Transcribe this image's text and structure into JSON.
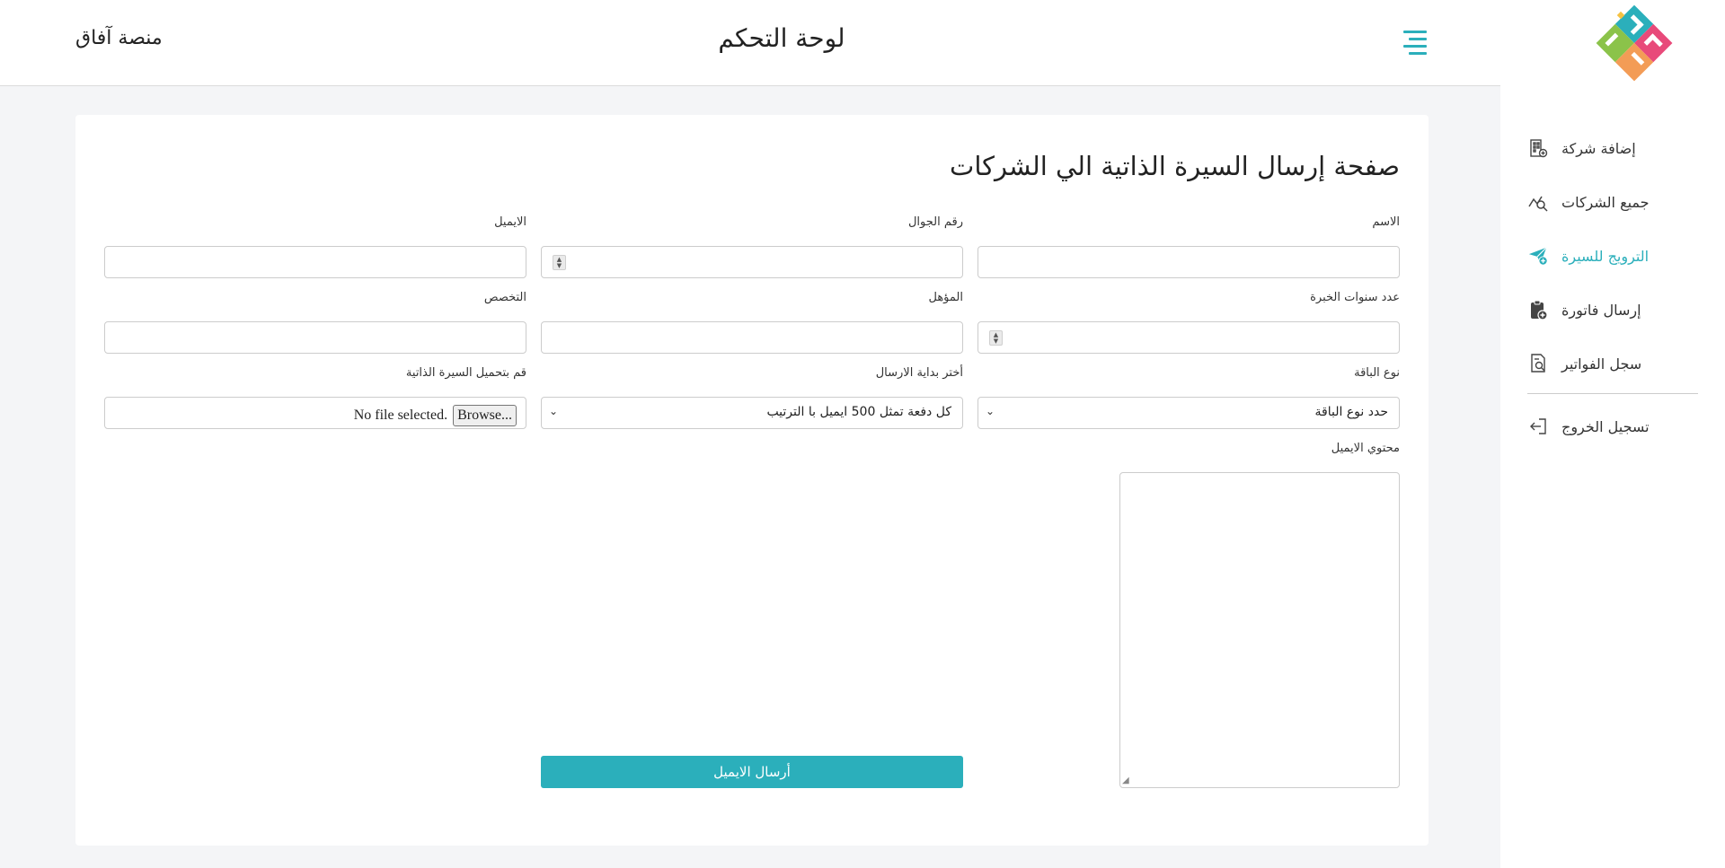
{
  "header": {
    "brand": "منصة آفاق",
    "title": "لوحة التحكم",
    "menu_icon": "hamburger-menu-icon"
  },
  "sidebar": {
    "logo": "afaq-logo",
    "items": [
      {
        "label": "إضافة شركة",
        "icon": "building-add-icon",
        "active": false
      },
      {
        "label": "جميع الشركات",
        "icon": "chart-search-icon",
        "active": false
      },
      {
        "label": "الترويج للسيرة",
        "icon": "paper-plane-icon",
        "active": true
      },
      {
        "label": "إرسال فاتورة",
        "icon": "clipboard-add-icon",
        "active": false
      },
      {
        "label": "سجل الفواتير",
        "icon": "document-search-icon",
        "active": false
      }
    ],
    "logout": {
      "label": "تسجيل الخروج",
      "icon": "logout-icon"
    }
  },
  "form": {
    "title": "صفحة إرسال السيرة الذاتية الي الشركات",
    "fields": {
      "name": {
        "label": "الاسم",
        "value": ""
      },
      "phone": {
        "label": "رقم الجوال",
        "value": ""
      },
      "email": {
        "label": "الايميل",
        "value": ""
      },
      "experience": {
        "label": "عدد سنوات الخبرة",
        "value": ""
      },
      "qualification": {
        "label": "المؤهل",
        "value": ""
      },
      "specialty": {
        "label": "التخصص",
        "value": ""
      },
      "package": {
        "label": "نوع الباقة",
        "selected": "حدد نوع الباقة"
      },
      "send_start": {
        "label": "أختر بداية الارسال",
        "selected": "كل دفعة تمثل 500 ايميل با الترتيب"
      },
      "cv_upload": {
        "label": "قم بتحميل السيرة الذاتية",
        "browse": "Browse...",
        "status": "No file selected."
      },
      "email_content": {
        "label": "محتوي الايميل",
        "value": ""
      }
    },
    "submit_label": "أرسال الايميل"
  },
  "colors": {
    "accent": "#2bafbb",
    "background": "#f4f5f7",
    "card": "#ffffff"
  }
}
